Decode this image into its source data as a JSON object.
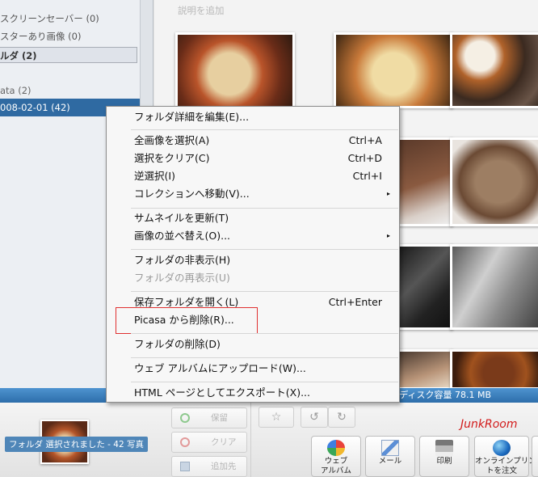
{
  "sidebar": {
    "screensaver_label": "スクリーンセーバー (0)",
    "starred_label": "スターあり画像 (0)",
    "folders_label": "ルダ (2)",
    "data_label": "ata (2)",
    "selected_folder_label": "008-02-01 (42)"
  },
  "main": {
    "caption_placeholder": "説明を追加"
  },
  "status": {
    "disk_text": "まで ディスク容量 78.1 MB"
  },
  "context_menu": {
    "edit_folder": "フォルダ詳細を編集(E)...",
    "select_all": {
      "label": "全画像を選択(A)",
      "shortcut": "Ctrl+A"
    },
    "clear_selection": {
      "label": "選択をクリア(C)",
      "shortcut": "Ctrl+D"
    },
    "invert_selection": {
      "label": "逆選択(I)",
      "shortcut": "Ctrl+I"
    },
    "move_collection": "コレクションへ移動(V)...",
    "refresh_thumbs": "サムネイルを更新(T)",
    "sort_images": "画像の並べ替え(O)...",
    "hide_folder": "フォルダの非表示(H)",
    "unhide_folder": "フォルダの再表示(U)",
    "open_folder": {
      "label": "保存フォルダを開く(L)",
      "shortcut": "Ctrl+Enter"
    },
    "remove_picasa": "Picasa から削除(R)...",
    "delete_folder": "フォルダの削除(D)",
    "upload_album": "ウェブ アルバムにアップロード(W)...",
    "export_html": "HTML ページとしてエクスポート(X)...",
    "submenu_arrow": "▸",
    "highlight_color": "#e03030"
  },
  "tray": {
    "selection_label": "フォルダ 選択されました - 42 写真",
    "hold_label": "保留",
    "clear_label": "クリア",
    "add_label": "追加先",
    "star_glyph": "☆",
    "rotate_left_glyph": "↺",
    "rotate_right_glyph": "↻",
    "brand": "JunkRoom",
    "web_album_line1": "ウェブ",
    "web_album_line2": "アルバム",
    "mail_label": "メール",
    "print_label": "印刷",
    "order_line1": "オンラインプリン",
    "order_line2": "トを注文"
  },
  "colors": {
    "selection_blue": "#2f6aa2",
    "status_bar": "#3a7fbf",
    "brand_red": "#d21b1b"
  }
}
